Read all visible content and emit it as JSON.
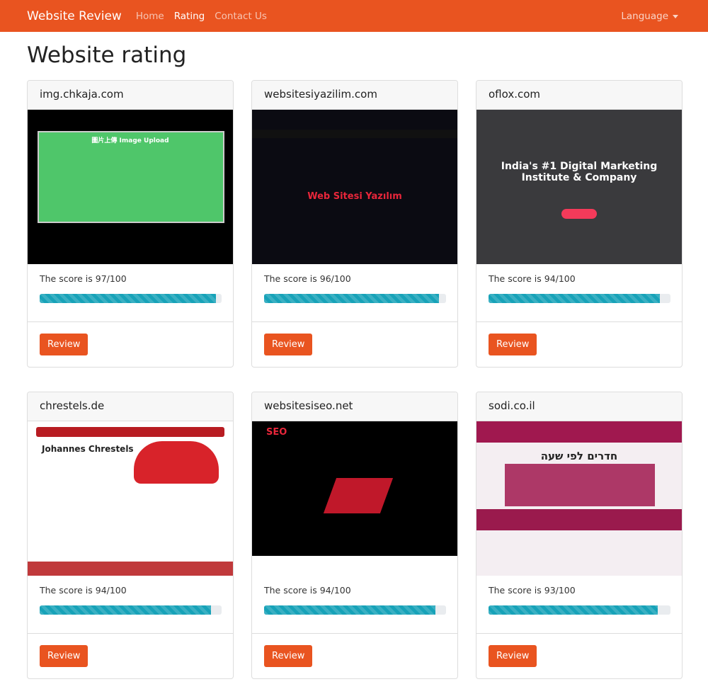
{
  "nav": {
    "brand": "Website Review",
    "links": [
      "Home",
      "Rating",
      "Contact Us"
    ],
    "active": "Rating",
    "language": "Language"
  },
  "page_title": "Website rating",
  "colors": {
    "brand": "#e95420",
    "progress": "#17a2b8"
  },
  "cards": [
    {
      "domain": "img.chkaja.com",
      "score_text": "The score is 97/100",
      "score": 97,
      "button": "Review",
      "thumb_text": "圖片上傳 Image Upload"
    },
    {
      "domain": "websitesiyazilim.com",
      "score_text": "The score is 96/100",
      "score": 96,
      "button": "Review",
      "thumb_text": "Web Sitesi Yazılım"
    },
    {
      "domain": "oflox.com",
      "score_text": "The score is 94/100",
      "score": 94,
      "button": "Review",
      "thumb_text": "India's #1 Digital Marketing Institute & Company"
    },
    {
      "domain": "chrestels.de",
      "score_text": "The score is 94/100",
      "score": 94,
      "button": "Review",
      "thumb_text": "Johannes Chrestels"
    },
    {
      "domain": "websitesiseo.net",
      "score_text": "The score is 94/100",
      "score": 94,
      "button": "Review",
      "thumb_text": "SEO"
    },
    {
      "domain": "sodi.co.il",
      "score_text": "The score is 93/100",
      "score": 93,
      "button": "Review",
      "thumb_text": "חדרים לפי שעה"
    }
  ]
}
